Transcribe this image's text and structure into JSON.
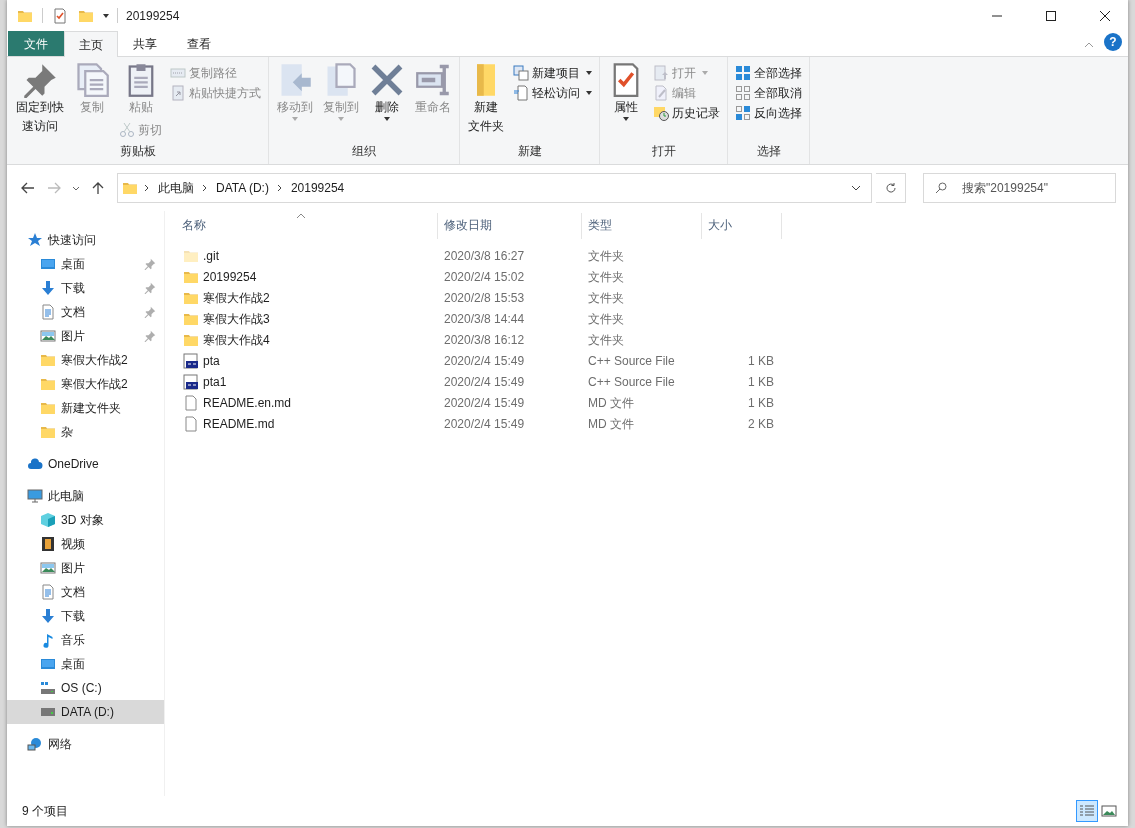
{
  "window": {
    "title": "20199254",
    "quick_access_toolbar": [
      {
        "kind": "folder"
      },
      {
        "kind": "properties"
      },
      {
        "kind": "newfolder"
      }
    ],
    "help_button": "?"
  },
  "ribbon_tabs": [
    {
      "label": "文件",
      "kind": "file",
      "selected": false
    },
    {
      "label": "主页",
      "kind": "tab",
      "selected": true
    },
    {
      "label": "共享",
      "kind": "tab",
      "selected": false
    },
    {
      "label": "查看",
      "kind": "tab",
      "selected": false
    }
  ],
  "ribbon_groups": [
    {
      "label": "剪贴板",
      "columns": [
        {
          "large": {
            "label": [
              "固定到快",
              "速访问"
            ],
            "kind": "pin",
            "disabled": false
          }
        },
        {
          "large": {
            "label": [
              "复制"
            ],
            "kind": "copy",
            "disabled": true
          }
        },
        {
          "large": {
            "label": [
              "粘贴"
            ],
            "kind": "paste",
            "disabled": true
          },
          "small": [
            {
              "label": "剪切",
              "kind": "cut",
              "disabled": true
            }
          ]
        },
        {
          "small": [
            {
              "label": "复制路径",
              "kind": "copypath",
              "disabled": true
            },
            {
              "label": "粘贴快捷方式",
              "kind": "shortcut",
              "disabled": true
            }
          ]
        }
      ]
    },
    {
      "label": "组织",
      "columns": [
        {
          "large": {
            "label": [
              "移动到"
            ],
            "kind": "move",
            "disabled": true,
            "caret": true
          }
        },
        {
          "large": {
            "label": [
              "复制到"
            ],
            "kind": "copyto",
            "disabled": true,
            "caret": true
          }
        },
        {
          "large": {
            "label": [
              "删除"
            ],
            "kind": "delete",
            "disabled": false,
            "caret": true
          }
        },
        {
          "large": {
            "label": [
              "重命名"
            ],
            "kind": "rename",
            "disabled": true
          }
        }
      ]
    },
    {
      "label": "新建",
      "columns": [
        {
          "large": {
            "label": [
              "新建",
              "文件夹"
            ],
            "kind": "newfolder",
            "disabled": false
          }
        },
        {
          "small": [
            {
              "label": "新建项目",
              "kind": "newitem",
              "disabled": false,
              "caret": true
            },
            {
              "label": "轻松访问",
              "kind": "easyaccess",
              "disabled": false,
              "caret": true
            }
          ]
        }
      ]
    },
    {
      "label": "打开",
      "columns": [
        {
          "large": {
            "label": [
              "属性"
            ],
            "kind": "properties",
            "disabled": false,
            "caret": true
          }
        },
        {
          "small": [
            {
              "label": "打开",
              "kind": "open",
              "disabled": true,
              "caret": true
            },
            {
              "label": "编辑",
              "kind": "edit",
              "disabled": true
            },
            {
              "label": "历史记录",
              "kind": "history",
              "disabled": false
            }
          ]
        }
      ]
    },
    {
      "label": "选择",
      "columns": [
        {
          "small": [
            {
              "label": "全部选择",
              "kind": "selectall",
              "disabled": false
            },
            {
              "label": "全部取消",
              "kind": "selectnone",
              "disabled": false
            },
            {
              "label": "反向选择",
              "kind": "invert",
              "disabled": false
            }
          ]
        }
      ]
    }
  ],
  "navigation": {
    "back_disabled": false,
    "forward_disabled": true,
    "breadcrumbs": [
      "此电脑",
      "DATA (D:)",
      "20199254"
    ],
    "search": {
      "placeholder": "搜索\"20199254\""
    }
  },
  "sidebar": {
    "items": [
      {
        "label": "快速访问",
        "kind": "star",
        "selected": false,
        "children": [
          {
            "label": "桌面",
            "kind": "desktop",
            "pinned": true,
            "selected": false
          },
          {
            "label": "下载",
            "kind": "download",
            "pinned": true,
            "selected": false
          },
          {
            "label": "文档",
            "kind": "document",
            "pinned": true,
            "selected": false
          },
          {
            "label": "图片",
            "kind": "picture",
            "pinned": true,
            "selected": false
          },
          {
            "label": "寒假大作战2",
            "kind": "folder",
            "pinned": false,
            "selected": false
          },
          {
            "label": "寒假大作战2",
            "kind": "folder",
            "pinned": false,
            "selected": false
          },
          {
            "label": "新建文件夹",
            "kind": "folder",
            "pinned": false,
            "selected": false
          },
          {
            "label": "杂",
            "kind": "folder",
            "pinned": false,
            "selected": false
          }
        ]
      },
      {
        "label": "OneDrive",
        "kind": "cloud",
        "selected": false
      },
      {
        "label": "此电脑",
        "kind": "computer",
        "selected": false,
        "children": [
          {
            "label": "3D 对象",
            "kind": "cube",
            "selected": false
          },
          {
            "label": "视频",
            "kind": "video",
            "selected": false
          },
          {
            "label": "图片",
            "kind": "picture",
            "selected": false
          },
          {
            "label": "文档",
            "kind": "document",
            "selected": false
          },
          {
            "label": "下载",
            "kind": "download",
            "selected": false
          },
          {
            "label": "音乐",
            "kind": "music",
            "selected": false
          },
          {
            "label": "桌面",
            "kind": "desktop",
            "selected": false
          },
          {
            "label": "OS (C:)",
            "kind": "osdrive",
            "selected": false
          },
          {
            "label": "DATA (D:)",
            "kind": "drive",
            "selected": true
          }
        ]
      },
      {
        "label": "网络",
        "kind": "network",
        "selected": false
      }
    ]
  },
  "file_list": {
    "columns": [
      {
        "label": "名称",
        "sorted": true
      },
      {
        "label": "修改日期",
        "sorted": false
      },
      {
        "label": "类型",
        "sorted": false
      },
      {
        "label": "大小",
        "sorted": false
      }
    ],
    "rows": [
      {
        "name": ".git",
        "date": "2020/3/8 16:27",
        "type": "文件夹",
        "kind": "folder",
        "hidden": true
      },
      {
        "name": "20199254",
        "date": "2020/2/4 15:02",
        "type": "文件夹",
        "kind": "folder",
        "hidden": false
      },
      {
        "name": "寒假大作战2",
        "date": "2020/2/8 15:53",
        "type": "文件夹",
        "kind": "folder",
        "hidden": false
      },
      {
        "name": "寒假大作战3",
        "date": "2020/3/8 14:44",
        "type": "文件夹",
        "kind": "folder",
        "hidden": false
      },
      {
        "name": "寒假大作战4",
        "date": "2020/3/8 16:12",
        "type": "文件夹",
        "kind": "folder",
        "hidden": false
      },
      {
        "name": "pta",
        "date": "2020/2/4 15:49",
        "type": "C++ Source File",
        "size": "1 KB",
        "kind": "cpp",
        "hidden": false
      },
      {
        "name": "pta1",
        "date": "2020/2/4 15:49",
        "type": "C++ Source File",
        "size": "1 KB",
        "kind": "cpp",
        "hidden": false
      },
      {
        "name": "README.en.md",
        "date": "2020/2/4 15:49",
        "type": "MD 文件",
        "size": "1 KB",
        "kind": "md",
        "hidden": false
      },
      {
        "name": "README.md",
        "date": "2020/2/4 15:49",
        "type": "MD 文件",
        "size": "2 KB",
        "kind": "md",
        "hidden": false
      }
    ]
  },
  "status_bar": {
    "item_count": "9 个项目",
    "views": [
      {
        "kind": "details",
        "selected": true
      },
      {
        "kind": "largeicons",
        "selected": false
      }
    ]
  }
}
